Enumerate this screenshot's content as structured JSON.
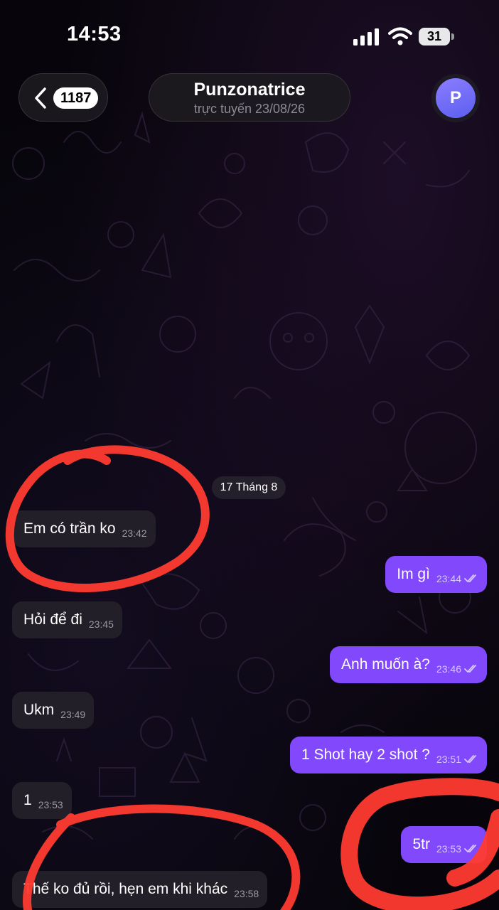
{
  "status_bar": {
    "time": "14:53",
    "battery": "31"
  },
  "header": {
    "unread_count": "1187",
    "chat_name": "Punzonatrice",
    "chat_status": "trực tuyến 23/08/26",
    "avatar_letter": "P"
  },
  "date_separator": "17 Tháng 8",
  "messages": [
    {
      "direction": "in",
      "text": "Em có trần ko",
      "time": "23:42"
    },
    {
      "direction": "out",
      "text": "Im gì",
      "time": "23:44"
    },
    {
      "direction": "in",
      "text": "Hỏi để đi",
      "time": "23:45"
    },
    {
      "direction": "out",
      "text": "Anh muốn à?",
      "time": "23:46"
    },
    {
      "direction": "in",
      "text": "Ukm",
      "time": "23:49"
    },
    {
      "direction": "out",
      "text": "1 Shot hay 2 shot ?",
      "time": "23:51"
    },
    {
      "direction": "in",
      "text": "1",
      "time": "23:53"
    },
    {
      "direction": "out",
      "text": "5tr",
      "time": "23:53"
    },
    {
      "direction": "in",
      "text": "Thế ko đủ rồi, hẹn em khi khác",
      "time": "23:58"
    }
  ],
  "colors": {
    "outgoing_bubble": "#8148fc",
    "incoming_bubble": "#221f28",
    "annotation_red": "#ff3b30"
  }
}
